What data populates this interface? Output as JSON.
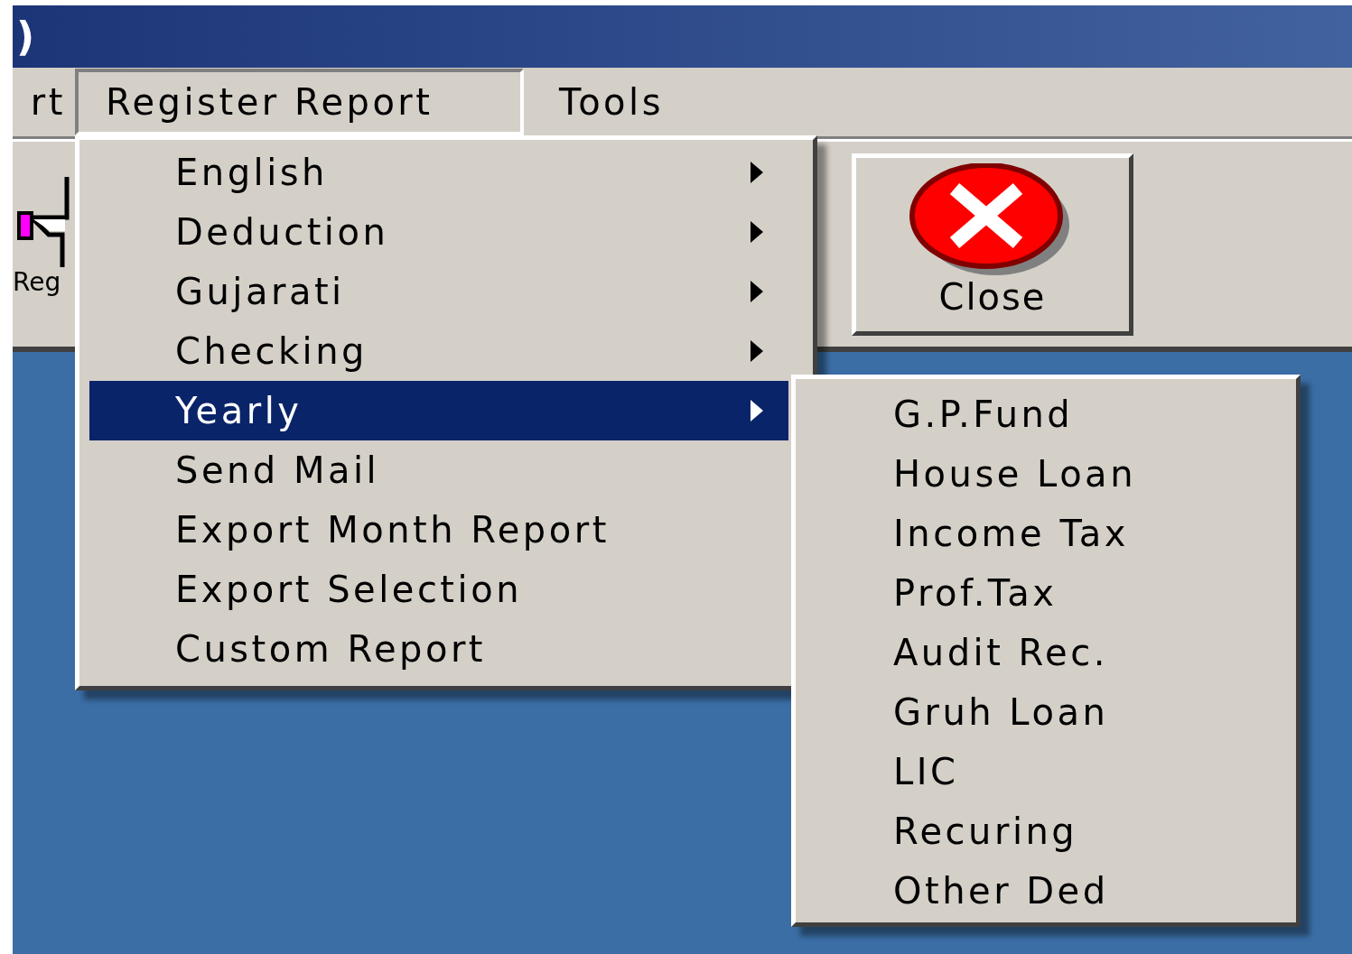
{
  "window": {
    "title": ")"
  },
  "menu_bar": [
    {
      "label": "rt",
      "selected": false
    },
    {
      "label": "Register Report",
      "selected": true
    },
    {
      "label": "Tools",
      "selected": false
    }
  ],
  "toolbar": [
    {
      "label": "Reg",
      "kind": "partial"
    },
    {
      "label": "Close",
      "kind": "close"
    }
  ],
  "menu": {
    "items": [
      {
        "label": "English",
        "submenu": true,
        "selected": false
      },
      {
        "label": "Deduction",
        "submenu": true,
        "selected": false
      },
      {
        "label": "Gujarati",
        "submenu": true,
        "selected": false
      },
      {
        "label": "Checking",
        "submenu": true,
        "selected": false
      },
      {
        "label": "Yearly",
        "submenu": true,
        "selected": true
      },
      {
        "label": "Send Mail",
        "submenu": false,
        "selected": false
      },
      {
        "label": "Export Month Report",
        "submenu": false,
        "selected": false
      },
      {
        "label": "Export Selection",
        "submenu": false,
        "selected": false
      },
      {
        "label": "Custom Report",
        "submenu": false,
        "selected": false
      }
    ]
  },
  "submenu": {
    "items": [
      {
        "label": "G.P.Fund",
        "selected": false
      },
      {
        "label": "House Loan",
        "selected": false
      },
      {
        "label": "Income Tax",
        "selected": false
      },
      {
        "label": "Prof.Tax",
        "selected": false
      },
      {
        "label": "Audit Rec.",
        "selected": false
      },
      {
        "label": "Gruh Loan",
        "selected": false
      },
      {
        "label": "LIC",
        "selected": false
      },
      {
        "label": "Recuring",
        "selected": false
      },
      {
        "label": "Other Ded",
        "selected": false
      }
    ]
  }
}
